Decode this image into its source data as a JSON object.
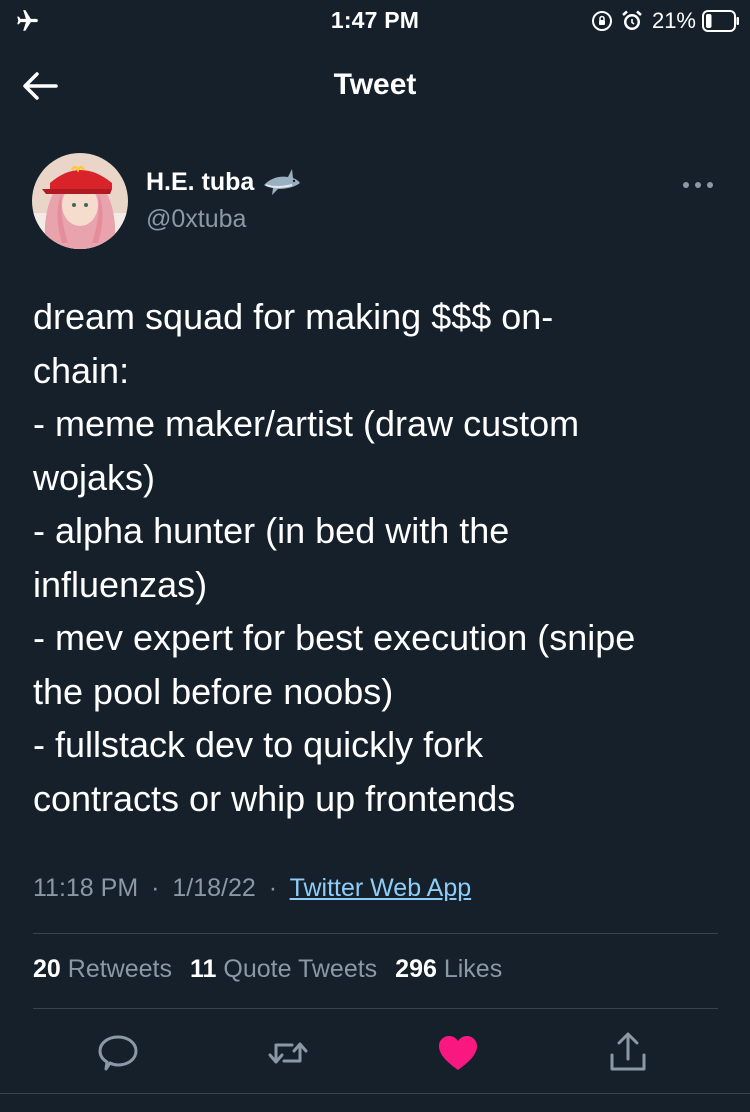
{
  "status_bar": {
    "time": "1:47 PM",
    "battery_percent": "21%",
    "battery_level": 0.21,
    "icons": [
      "airplane-icon",
      "orientation-lock-icon",
      "alarm-icon",
      "battery-icon"
    ]
  },
  "header": {
    "title": "Tweet",
    "back_icon": "arrow-left-icon"
  },
  "author": {
    "name": "H.E. tuba",
    "handle": "@0xtuba",
    "emoji": "shark",
    "more_icon": "ellipsis-icon"
  },
  "tweet": {
    "lines": [
      "dream squad for making $$$ on-",
      "chain:",
      "- meme maker/artist (draw custom",
      "wojaks)",
      "- alpha hunter (in bed with the",
      "influenzas)",
      "- mev expert for best execution (snipe",
      "the pool before noobs)",
      "- fullstack dev to quickly fork",
      "contracts or whip up frontends"
    ]
  },
  "meta": {
    "time": "11:18 PM",
    "date": "1/18/22",
    "separator": "·",
    "source": "Twitter Web App"
  },
  "stats": {
    "retweets_count": "20",
    "retweets_label": "Retweets",
    "quotes_count": "11",
    "quotes_label": "Quote Tweets",
    "likes_count": "296",
    "likes_label": "Likes"
  },
  "actions": {
    "icons": [
      "reply-icon",
      "retweet-icon",
      "like-icon",
      "share-icon"
    ],
    "like_color": "#f91880"
  },
  "colors": {
    "background": "#15202b",
    "secondary_text": "#8b98a5",
    "link": "#8ecdf8",
    "divider": "#38444d"
  }
}
